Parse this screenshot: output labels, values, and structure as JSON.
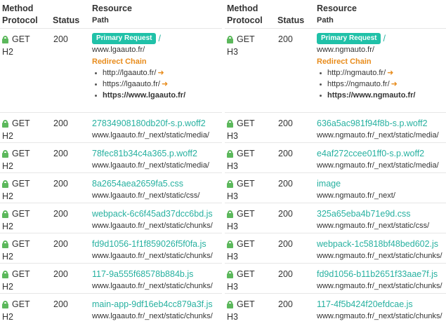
{
  "headers": {
    "method": "Method",
    "protocol": "Protocol",
    "status": "Status",
    "resource": "Resource",
    "path": "Path"
  },
  "colors": {
    "accent": "#27b1a0",
    "badge": "#20c1a8",
    "redirect": "#e88c1c",
    "lock": "#5cb85c"
  },
  "panels": [
    {
      "first": {
        "method": "GET",
        "protocol": "H2",
        "status": "200",
        "badge": "Primary Request",
        "slash": "/",
        "path": "www.lgaauto.fr/",
        "redirect_title": "Redirect Chain",
        "chain": [
          "http://lgaauto.fr/",
          "https://lgaauto.fr/",
          "https://www.lgaauto.fr/"
        ]
      },
      "rows": [
        {
          "method": "GET",
          "protocol": "H2",
          "status": "200",
          "name": "27834908180db20f-s.p.woff2",
          "path": "www.lgaauto.fr/_next/static/media/"
        },
        {
          "method": "GET",
          "protocol": "H2",
          "status": "200",
          "name": "78fec81b34c4a365.p.woff2",
          "path": "www.lgaauto.fr/_next/static/media/"
        },
        {
          "method": "GET",
          "protocol": "H2",
          "status": "200",
          "name": "8a2654aea2659fa5.css",
          "path": "www.lgaauto.fr/_next/static/css/"
        },
        {
          "method": "GET",
          "protocol": "H2",
          "status": "200",
          "name": "webpack-6c6f45ad37dcc6bd.js",
          "path": "www.lgaauto.fr/_next/static/chunks/"
        },
        {
          "method": "GET",
          "protocol": "H2",
          "status": "200",
          "name": "fd9d1056-1f1f859026f5f0fa.js",
          "path": "www.lgaauto.fr/_next/static/chunks/"
        },
        {
          "method": "GET",
          "protocol": "H2",
          "status": "200",
          "name": "117-9a555f68578b884b.js",
          "path": "www.lgaauto.fr/_next/static/chunks/"
        },
        {
          "method": "GET",
          "protocol": "H2",
          "status": "200",
          "name": "main-app-9df16eb4cc879a3f.js",
          "path": "www.lgaauto.fr/_next/static/chunks/"
        }
      ]
    },
    {
      "first": {
        "method": "GET",
        "protocol": "H3",
        "status": "200",
        "badge": "Primary Request",
        "slash": "/",
        "path": "www.ngmauto.fr/",
        "redirect_title": "Redirect Chain",
        "chain": [
          "http://ngmauto.fr/",
          "https://ngmauto.fr/",
          "https://www.ngmauto.fr/"
        ]
      },
      "rows": [
        {
          "method": "GET",
          "protocol": "H3",
          "status": "200",
          "name": "636a5ac981f94f8b-s.p.woff2",
          "path": "www.ngmauto.fr/_next/static/media/"
        },
        {
          "method": "GET",
          "protocol": "H3",
          "status": "200",
          "name": "e4af272ccee01ff0-s.p.woff2",
          "path": "www.ngmauto.fr/_next/static/media/"
        },
        {
          "method": "GET",
          "protocol": "H3",
          "status": "200",
          "name": "image",
          "path": "www.ngmauto.fr/_next/"
        },
        {
          "method": "GET",
          "protocol": "H3",
          "status": "200",
          "name": "325a65eba4b71e9d.css",
          "path": "www.ngmauto.fr/_next/static/css/"
        },
        {
          "method": "GET",
          "protocol": "H3",
          "status": "200",
          "name": "webpack-1c5818bf48bed602.js",
          "path": "www.ngmauto.fr/_next/static/chunks/"
        },
        {
          "method": "GET",
          "protocol": "H3",
          "status": "200",
          "name": "fd9d1056-b11b2651f33aae7f.js",
          "path": "www.ngmauto.fr/_next/static/chunks/"
        },
        {
          "method": "GET",
          "protocol": "H3",
          "status": "200",
          "name": "117-4f5b424f20efdcae.js",
          "path": "www.ngmauto.fr/_next/static/chunks/"
        }
      ]
    }
  ]
}
